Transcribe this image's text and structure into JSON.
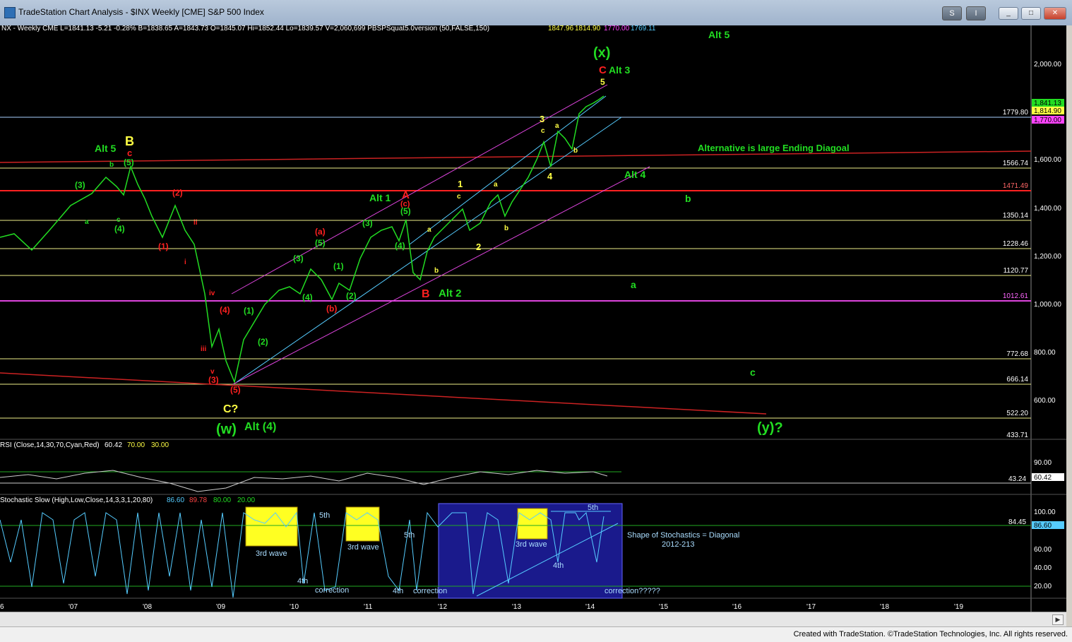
{
  "window": {
    "title": "TradeStation Chart Analysis - $INX Weekly [CME] S&P 500 Index",
    "btn_s": "S",
    "btn_i": "I",
    "minimize": "_",
    "maximize": "□",
    "close": "✕"
  },
  "status": {
    "credit": "Created with TradeStation. ©TradeStation Technologies, Inc. All rights reserved."
  },
  "chart": {
    "symbol_line": "NX - Weekly  CME  L=1841.13  -5.21  -0.28%  B=1838.65  A=1843.73  O=1845.07  Hi=1852.44  Lo=1839.57  V=2,060,699  PBSPSquat5.0version (50,FALSE,150)",
    "indicator_values": [
      "1847.96",
      "1814.90",
      "1770.00",
      "1769.11"
    ],
    "rsi_label": "RSI (Close,14,30,70,Cyan,Red)",
    "rsi_values": [
      "60.42",
      "70.00",
      "30.00"
    ],
    "stoch_label": "Stochastic Slow (High,Low,Close,14,3,3,1,20,80)",
    "stoch_values": [
      "86.60",
      "89.78",
      "80.00",
      "20.00"
    ],
    "price_axis": [
      "2,000.00",
      "1,800.00",
      "1,600.00",
      "1,400.00",
      "1,200.00",
      "1,000.00",
      "800.00",
      "600.00"
    ],
    "h_levels": [
      "1779.80",
      "1566.74",
      "1471.49",
      "1350.14",
      "1228.46",
      "1120.77",
      "1012.61",
      "772.68",
      "666.14",
      "522.20",
      "433.71"
    ],
    "price_tags": [
      "1,841.13",
      "1,814.90",
      "1,770.00"
    ],
    "rsi_axis": [
      "90.00",
      "43.24",
      "60.42"
    ],
    "stoch_axis": [
      "100.00",
      "84.45",
      "86.60",
      "60.00",
      "40.00",
      "20.00"
    ],
    "x_axis": [
      "6",
      "'07",
      "'08",
      "'09",
      "'10",
      "'11",
      "'12",
      "'13",
      "'14",
      "'15",
      "'16",
      "'17",
      "'18",
      "'19"
    ],
    "annotations": {
      "x_top": "(x)",
      "alt5_right": "Alt 5",
      "c_red": "C",
      "alt3": "Alt 3",
      "five_top": "5",
      "ending_diagonal": "Alternative is large Ending Diagoal",
      "alt4": "Alt 4",
      "b_right": "b",
      "a_right": "a",
      "c_right": "c",
      "y_q": "(y)?",
      "alt5_left": "Alt 5",
      "B_yellow": "B",
      "c_red_left": "c",
      "b_small": "b",
      "five_paren": "(5)",
      "three_paren": "(3)",
      "a_small": "a",
      "c_small": "c",
      "four_paren": "(4)",
      "two_red": "(2)",
      "one_red": "(1)",
      "ii": "ii",
      "i": "i",
      "iv": "iv",
      "iii": "iii",
      "v": "v",
      "four_red": "(4)",
      "three_red": "(3)",
      "five_red": "(5)",
      "c_q": "C?",
      "w_paren": "(w)",
      "alt4_paren": "Alt (4)",
      "one_g": "(1)",
      "two_g": "(2)",
      "three_g": "(3)",
      "four_g": "(4)",
      "five_g": "(5)",
      "a_red_paren": "(a)",
      "b_red_paren": "(b)",
      "one_g2": "(1)",
      "two_g2": "(2)",
      "alt1": "Alt 1",
      "A_red": "A",
      "c_red_paren": "(c)",
      "five_g2": "(5)",
      "three_g2": "(3)",
      "four_g2": "(4)",
      "B_red": "B",
      "alt2": "Alt 2",
      "one_y": "1",
      "c_y": "c",
      "a_y": "a",
      "b_y": "b",
      "two_y": "2",
      "a_y2": "a",
      "b_y2": "b",
      "three_y": "3",
      "c_y2": "c",
      "a_y3": "a",
      "b_y3": "b",
      "four_y": "4"
    },
    "stoch_notes": {
      "third1": "3rd wave",
      "third2": "3rd wave",
      "third3": "3rd wave",
      "fifth1": "5th",
      "fifth2": "5th",
      "fifth3": "5th",
      "fourth1": "4th",
      "fourth2": "4th",
      "fourth3": "4th",
      "corr1": "correction",
      "corr2": "correction",
      "corr3": "correction?????",
      "shape": "Shape of Stochastics = Diagonal",
      "years": "2012-213"
    },
    "colors": {
      "green": "#22dd22",
      "yellow": "#ffff44",
      "red": "#ff2020",
      "magenta": "#ff44ff",
      "cyan": "#55ccff"
    }
  }
}
